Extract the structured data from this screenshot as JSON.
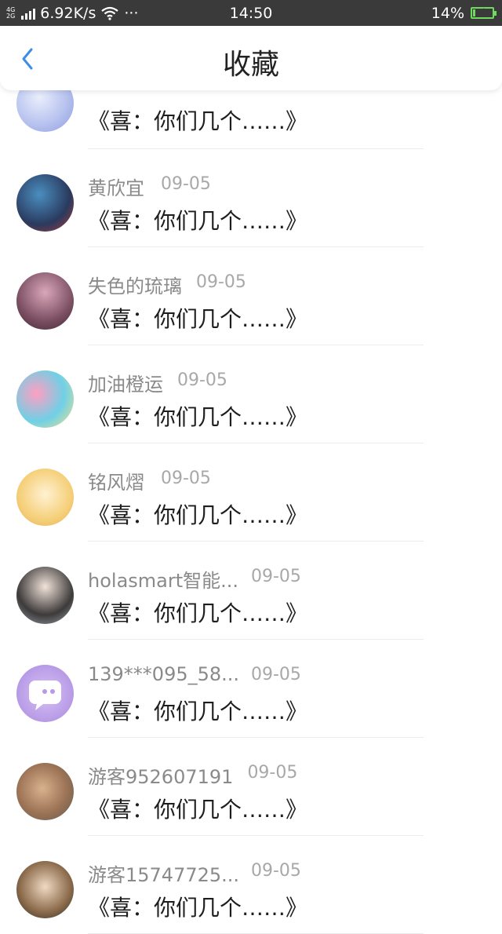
{
  "status_bar": {
    "network": "4G",
    "network2": "2G",
    "speed": "6.92K/s",
    "dots": "···",
    "time": "14:50",
    "battery": "14%",
    "battery_level": 0.14
  },
  "header": {
    "title": "收藏",
    "back_icon": "chevron-left-icon",
    "accent_color": "#3a8ee6"
  },
  "items": [
    {
      "name": "",
      "date": "",
      "message": "《喜：你们几个……》"
    },
    {
      "name": "黄欣宜",
      "date": "09-05",
      "message": "《喜：你们几个……》"
    },
    {
      "name": "失色的琉璃",
      "date": "09-05",
      "message": "《喜：你们几个……》"
    },
    {
      "name": "加油橙运",
      "date": "09-05",
      "message": "《喜：你们几个……》"
    },
    {
      "name": "铭风熠",
      "date": "09-05",
      "message": "《喜：你们几个……》"
    },
    {
      "name": "holasmart智能...",
      "date": "09-05",
      "message": "《喜：你们几个……》"
    },
    {
      "name": "139***095_58...",
      "date": "09-05",
      "message": "《喜：你们几个……》"
    },
    {
      "name": "游客952607191",
      "date": "09-05",
      "message": "《喜：你们几个……》"
    },
    {
      "name": "游客15747725...",
      "date": "09-05",
      "message": "《喜：你们几个……》"
    }
  ]
}
